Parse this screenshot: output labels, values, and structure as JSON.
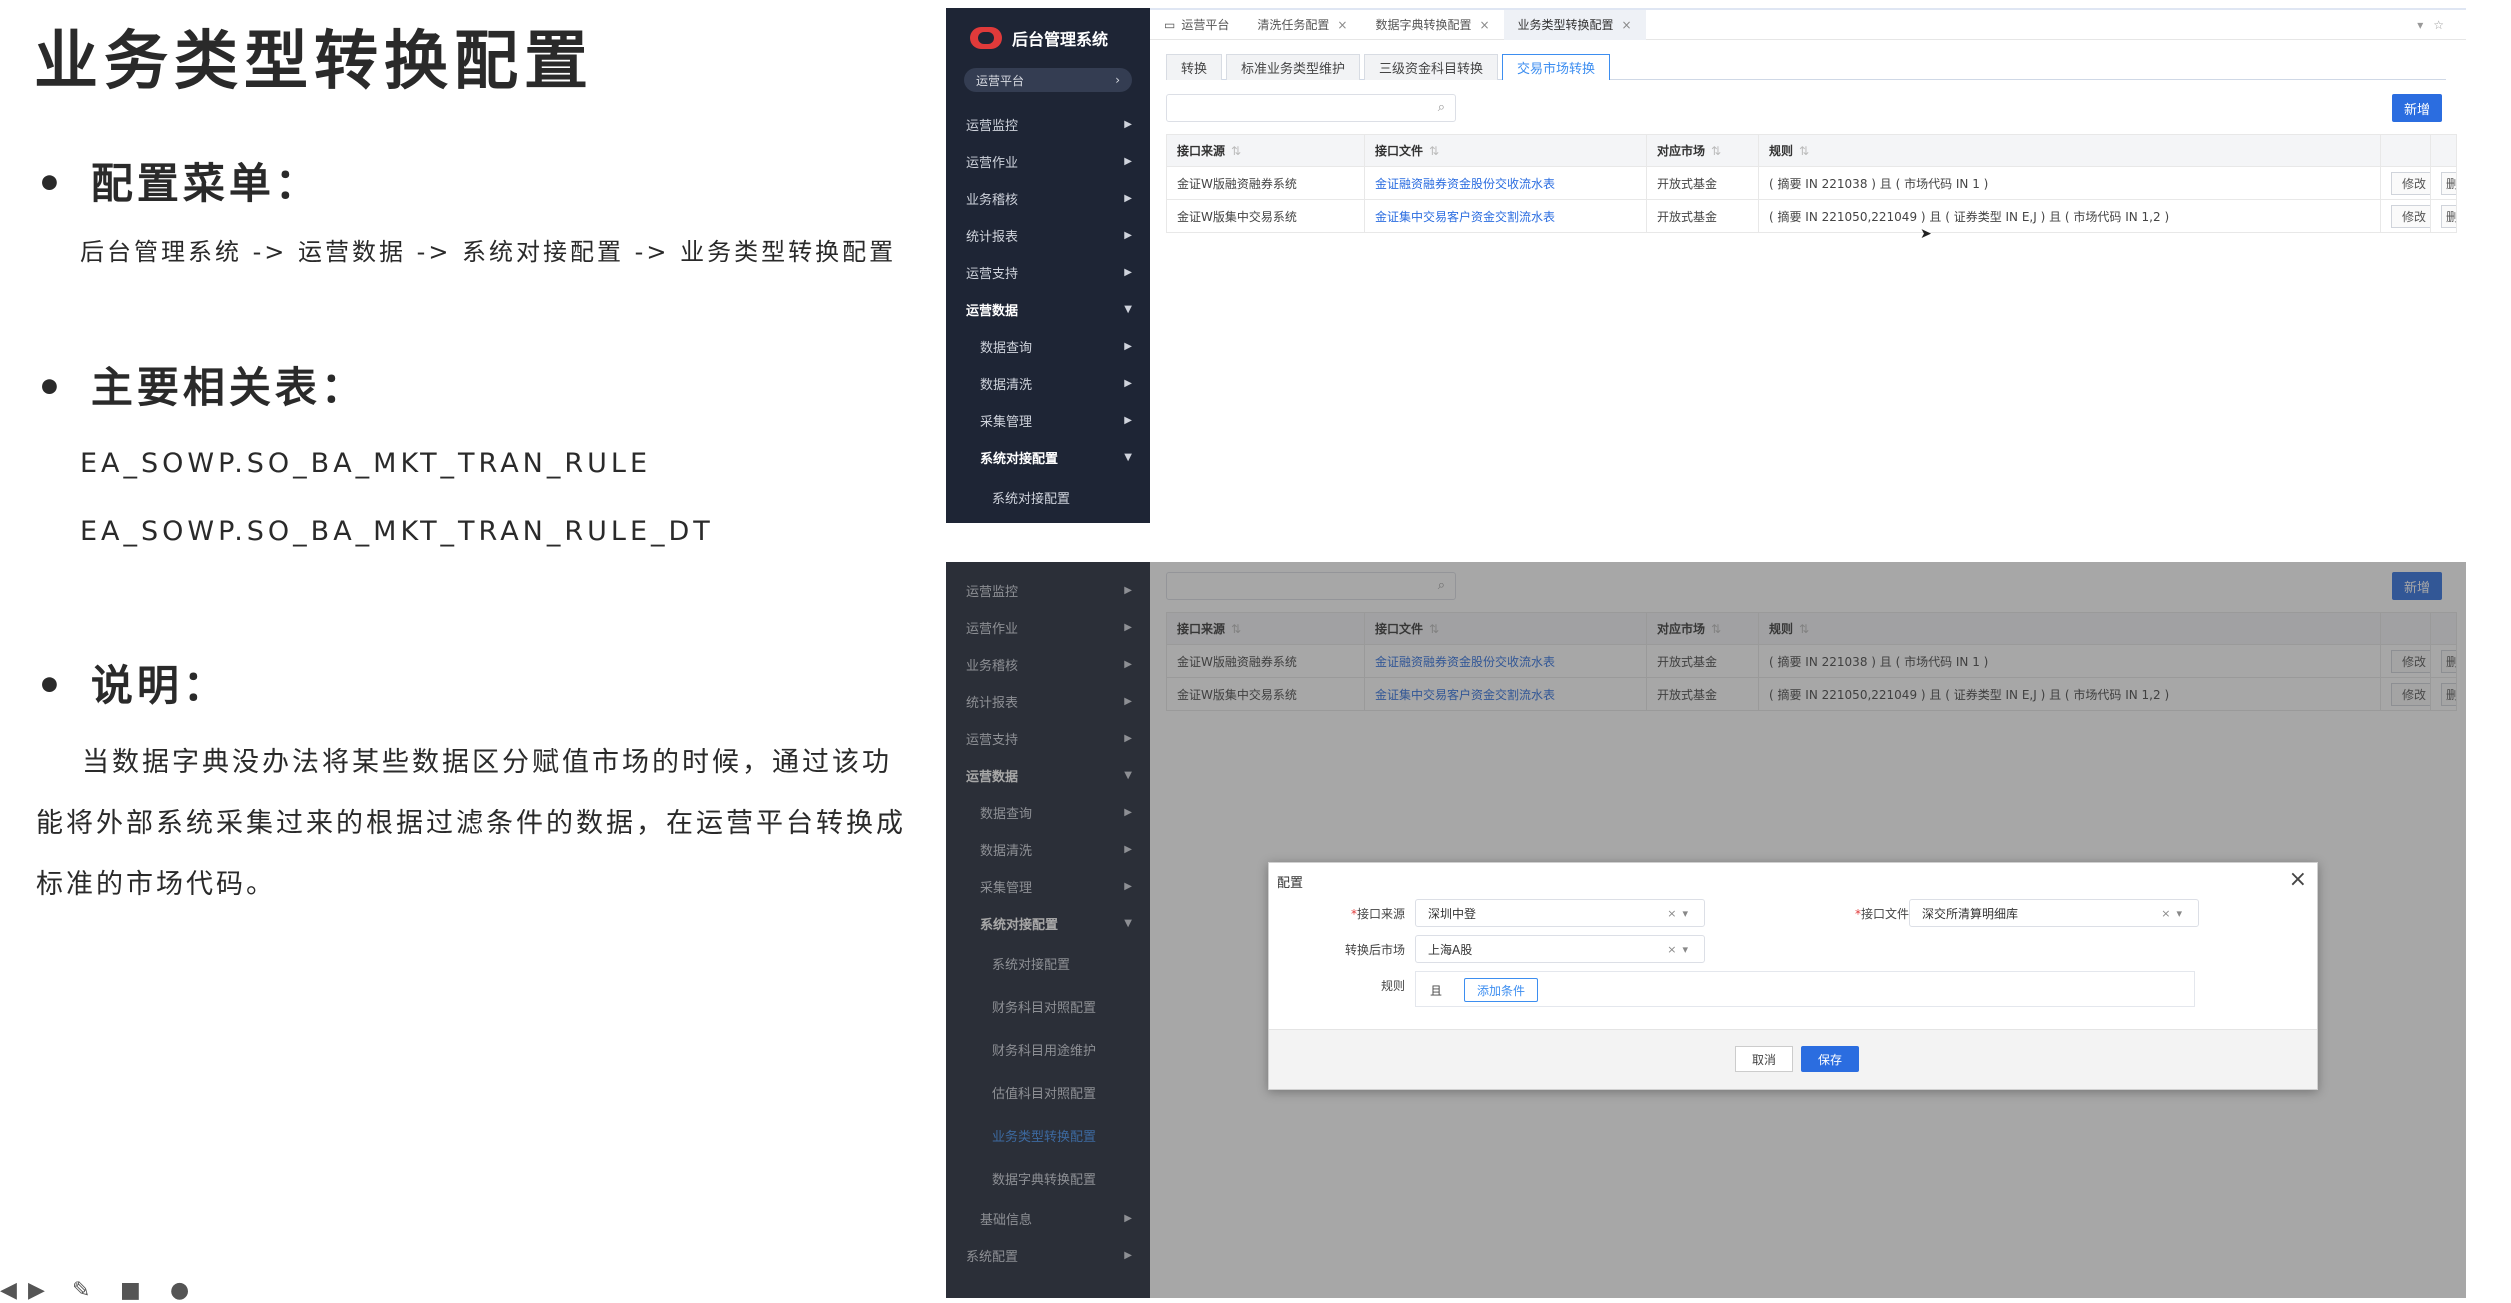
{
  "slide": {
    "title": "业务类型转换配置",
    "section_menu": "配置菜单：",
    "menu_path": "后台管理系统 -> 运营数据 -> 系统对接配置 -> 业务类型转换配置",
    "section_tables": "主要相关表：",
    "table_1": "EA_SOWP.SO_BA_MKT_TRAN_RULE",
    "table_2": "EA_SOWP.SO_BA_MKT_TRAN_RULE_DT",
    "section_note": "说明：",
    "note": "当数据字典没办法将某些数据区分赋值市场的时候，通过该功能将外部系统采集过来的根据过滤条件的数据，在运营平台转换成标准的市场代码。"
  },
  "app": {
    "brand": "后台管理系统",
    "platform": "运营平台",
    "nav_top": [
      "运营监控",
      "运营作业",
      "业务稽核",
      "统计报表",
      "运营支持",
      "运营数据",
      "数据查询",
      "数据清洗",
      "采集管理",
      "系统对接配置",
      "系统对接配置"
    ],
    "nav_bottom": [
      "运营监控",
      "运营作业",
      "业务稽核",
      "统计报表",
      "运营支持",
      "运营数据",
      "数据查询",
      "数据清洗",
      "采集管理",
      "系统对接配置",
      "系统对接配置",
      "财务科目对照配置",
      "财务科目用途维护",
      "估值科目对照配置",
      "业务类型转换配置",
      "数据字典转换配置",
      "基础信息",
      "系统配置"
    ],
    "page_tabs": [
      "运营平台",
      "清洗任务配置",
      "数据字典转换配置",
      "业务类型转换配置"
    ],
    "sub_tabs": [
      "转换",
      "标准业务类型维护",
      "三级资金科目转换",
      "交易市场转换"
    ],
    "add_label": "新增",
    "columns": [
      "接口来源",
      "接口文件",
      "对应市场",
      "规则"
    ],
    "rows": [
      {
        "source": "金证W版融资融券系统",
        "file": "金证融资融券资金股份交收流水表",
        "market": "开放式基金",
        "rule": "( 摘要 IN 221038 ) 且 ( 市场代码 IN 1 )",
        "edit": "修改",
        "del": "删"
      },
      {
        "source": "金证W版集中交易系统",
        "file": "金证集中交易客户资金交割流水表",
        "market": "开放式基金",
        "rule": "( 摘要 IN 221050,221049 ) 且 ( 证券类型 IN E,J ) 且 ( 市场代码 IN 1,2 )",
        "edit": "修改",
        "del": "删"
      }
    ],
    "dialog": {
      "title": "配置",
      "source_label": "接口来源",
      "source_value": "深圳中登",
      "file_label": "接口文件",
      "file_value": "深交所清算明细库",
      "market_label": "转换后市场",
      "market_value": "上海A股",
      "rule_label": "规则",
      "rule_and": "且",
      "add_condition": "添加条件",
      "cancel": "取消",
      "save": "保存"
    }
  }
}
